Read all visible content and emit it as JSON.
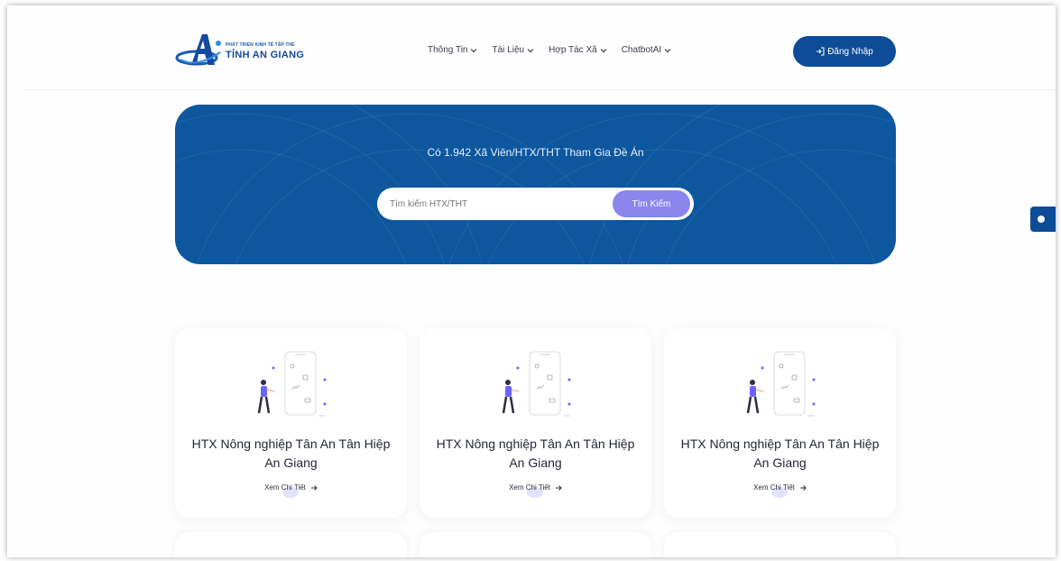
{
  "header": {
    "logo_small": "PHÁT TRIỂN KINH TẾ TẬP THỂ",
    "logo_big": "TỈNH AN GIANG",
    "nav": [
      {
        "label": "Thông Tin"
      },
      {
        "label": "Tài Liệu"
      },
      {
        "label": "Hợp Tác Xã"
      },
      {
        "label": "ChatbotAI"
      }
    ],
    "login_label": "Đăng Nhập"
  },
  "hero": {
    "title": "Có 1.942 Xã Viên/HTX/THT Tham Gia Đề Án",
    "search_placeholder": "Tìm kiếm HTX/THT",
    "search_button": "Tìm Kiếm"
  },
  "cards": [
    {
      "title": "HTX Nông nghiệp Tân An Tân Hiệp An Giang",
      "link": "Xem Chi Tiết"
    },
    {
      "title": "HTX Nông nghiệp Tân An Tân Hiệp An Giang",
      "link": "Xem Chi Tiết"
    },
    {
      "title": "HTX Nông nghiệp Tân An Tân Hiệp An Giang",
      "link": "Xem Chi Tiết"
    }
  ],
  "colors": {
    "primary": "#0d4c97",
    "hero_bg": "#0d579f",
    "accent_purple": "#8a86ee"
  },
  "icons": [
    "logo-a-mark",
    "chevron-down-icon",
    "login-icon",
    "arrow-right-icon",
    "mobile-user-illustration"
  ]
}
